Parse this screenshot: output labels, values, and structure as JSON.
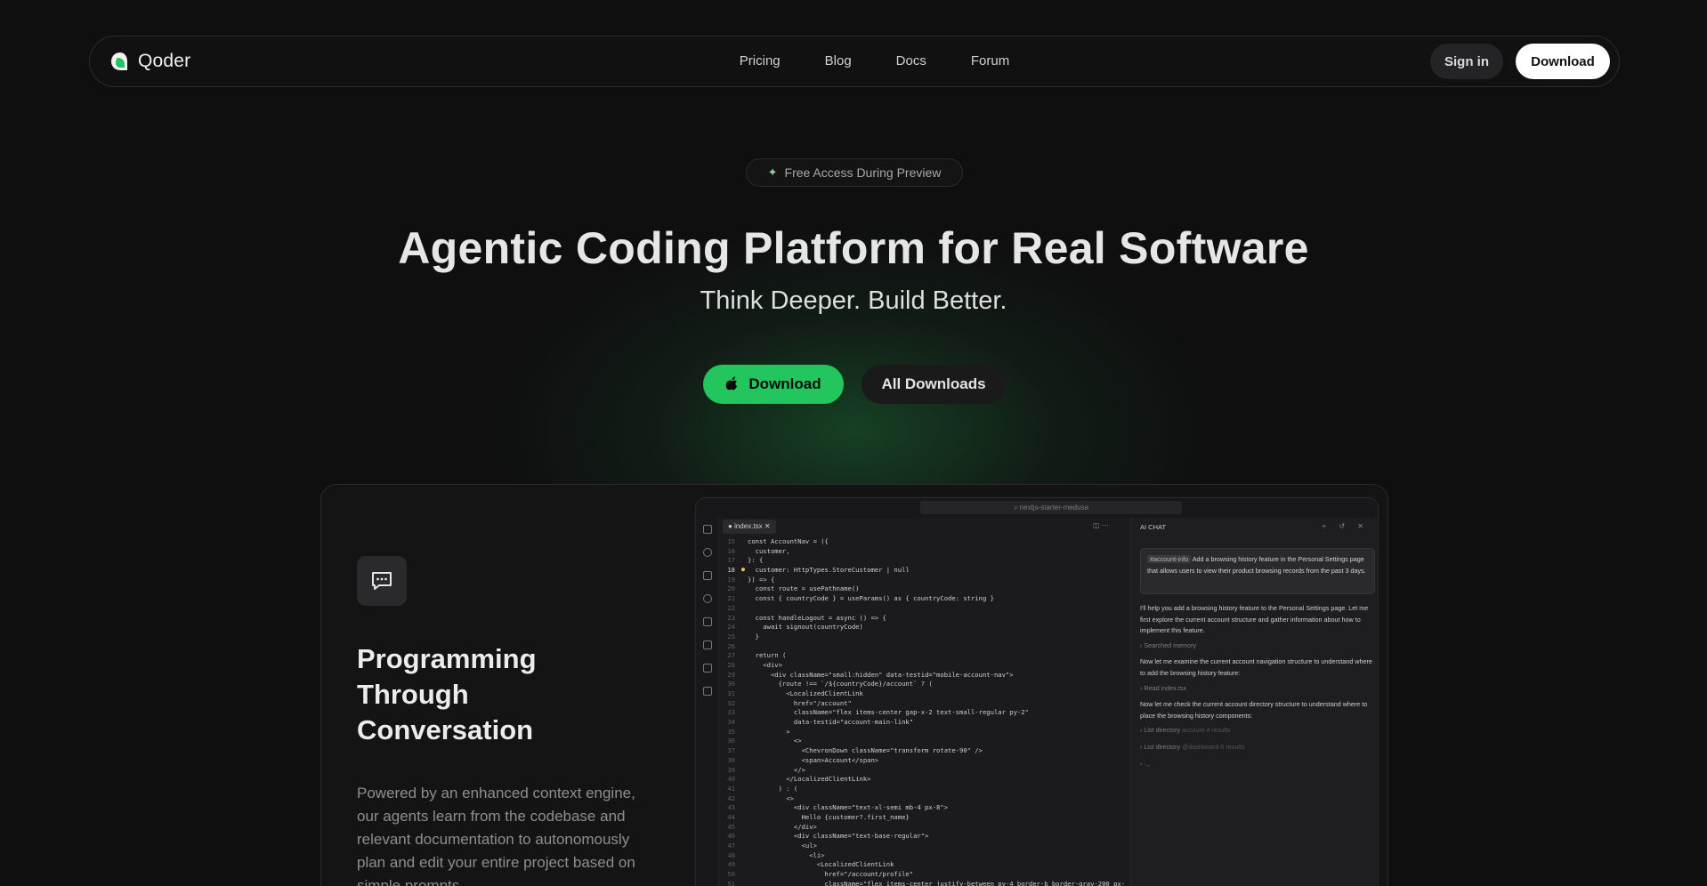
{
  "nav": {
    "brand": "Qoder",
    "links": [
      "Pricing",
      "Blog",
      "Docs",
      "Forum"
    ],
    "signin_label": "Sign in",
    "download_label": "Download"
  },
  "hero": {
    "badge": "Free Access During Preview",
    "title": "Agentic Coding Platform for Real Software",
    "subtitle": "Think Deeper. Build Better.",
    "download_label": "Download",
    "all_downloads_label": "All Downloads"
  },
  "feature": {
    "icon": "chat-bubble-icon",
    "title": "Programming Through Conversation",
    "description": "Powered by an enhanced context engine, our agents learn from the codebase and relevant documentation to autonomously plan and edit your entire project based on simple prompts."
  },
  "ide": {
    "search": "nextjs-starter-medusa",
    "tab": "index.tsx",
    "chat_title": "AI CHAT",
    "code_lines": [
      {
        "n": "15",
        "t": "const AccountNav = ({"
      },
      {
        "n": "16",
        "t": "  customer,"
      },
      {
        "n": "17",
        "t": "}: {"
      },
      {
        "n": "18",
        "t": "  customer: HttpTypes.StoreCustomer | null"
      },
      {
        "n": "19",
        "t": "}) => {"
      },
      {
        "n": "20",
        "t": "  const route = usePathname()"
      },
      {
        "n": "21",
        "t": "  const { countryCode } = useParams() as { countryCode: string }"
      },
      {
        "n": "22",
        "t": ""
      },
      {
        "n": "23",
        "t": "  const handleLogout = async () => {"
      },
      {
        "n": "24",
        "t": "    await signout(countryCode)"
      },
      {
        "n": "25",
        "t": "  }"
      },
      {
        "n": "26",
        "t": ""
      },
      {
        "n": "27",
        "t": "  return ("
      },
      {
        "n": "28",
        "t": "    <div>"
      },
      {
        "n": "29",
        "t": "      <div className=\"small:hidden\" data-testid=\"mobile-account-nav\">"
      },
      {
        "n": "30",
        "t": "        {route !== `/${countryCode}/account` ? ("
      },
      {
        "n": "31",
        "t": "          <LocalizedClientLink"
      },
      {
        "n": "32",
        "t": "            href=\"/account\""
      },
      {
        "n": "33",
        "t": "            className=\"flex items-center gap-x-2 text-small-regular py-2\""
      },
      {
        "n": "34",
        "t": "            data-testid=\"account-main-link\""
      },
      {
        "n": "35",
        "t": "          >"
      },
      {
        "n": "36",
        "t": "            <>"
      },
      {
        "n": "37",
        "t": "              <ChevronDown className=\"transform rotate-90\" />"
      },
      {
        "n": "38",
        "t": "              <span>Account</span>"
      },
      {
        "n": "39",
        "t": "            </>"
      },
      {
        "n": "40",
        "t": "          </LocalizedClientLink>"
      },
      {
        "n": "41",
        "t": "        ) : ("
      },
      {
        "n": "42",
        "t": "          <>"
      },
      {
        "n": "43",
        "t": "            <div className=\"text-xl-semi mb-4 px-8\">"
      },
      {
        "n": "44",
        "t": "              Hello {customer?.first_name}"
      },
      {
        "n": "45",
        "t": "            </div>"
      },
      {
        "n": "46",
        "t": "            <div className=\"text-base-regular\">"
      },
      {
        "n": "47",
        "t": "              <ul>"
      },
      {
        "n": "48",
        "t": "                <li>"
      },
      {
        "n": "49",
        "t": "                  <LocalizedClientLink"
      },
      {
        "n": "50",
        "t": "                    href=\"/account/profile\""
      },
      {
        "n": "51",
        "t": "                    className=\"flex items-center justify-between py-4 border-b border-gray-200 px-"
      }
    ],
    "chat": {
      "prompt_tag": "#account-info",
      "prompt_text": "Add a browsing history feature in the Personal Settings page that allows users to view their product browsing records from the past 3 days.",
      "messages": [
        {
          "kind": "text",
          "text": "I'll help you add a browsing history feature to the Personal Settings page. Let me first explore the current account structure and gather information about how to implement this feature."
        },
        {
          "kind": "step",
          "text": "Searched memory",
          "extra": ""
        },
        {
          "kind": "text",
          "text": "Now let me examine the current account navigation structure to understand where to add the browsing history feature:"
        },
        {
          "kind": "step",
          "text": "Read index.tsx",
          "extra": ""
        },
        {
          "kind": "text",
          "text": "Now let me check the current account directory structure to understand where to place the browsing history components:"
        },
        {
          "kind": "step",
          "text": "List directory",
          "extra": "account  4 results"
        },
        {
          "kind": "step",
          "text": "List directory",
          "extra": "@dashboard  6 results"
        },
        {
          "kind": "step",
          "text": "·.,",
          "extra": ""
        }
      ]
    }
  }
}
